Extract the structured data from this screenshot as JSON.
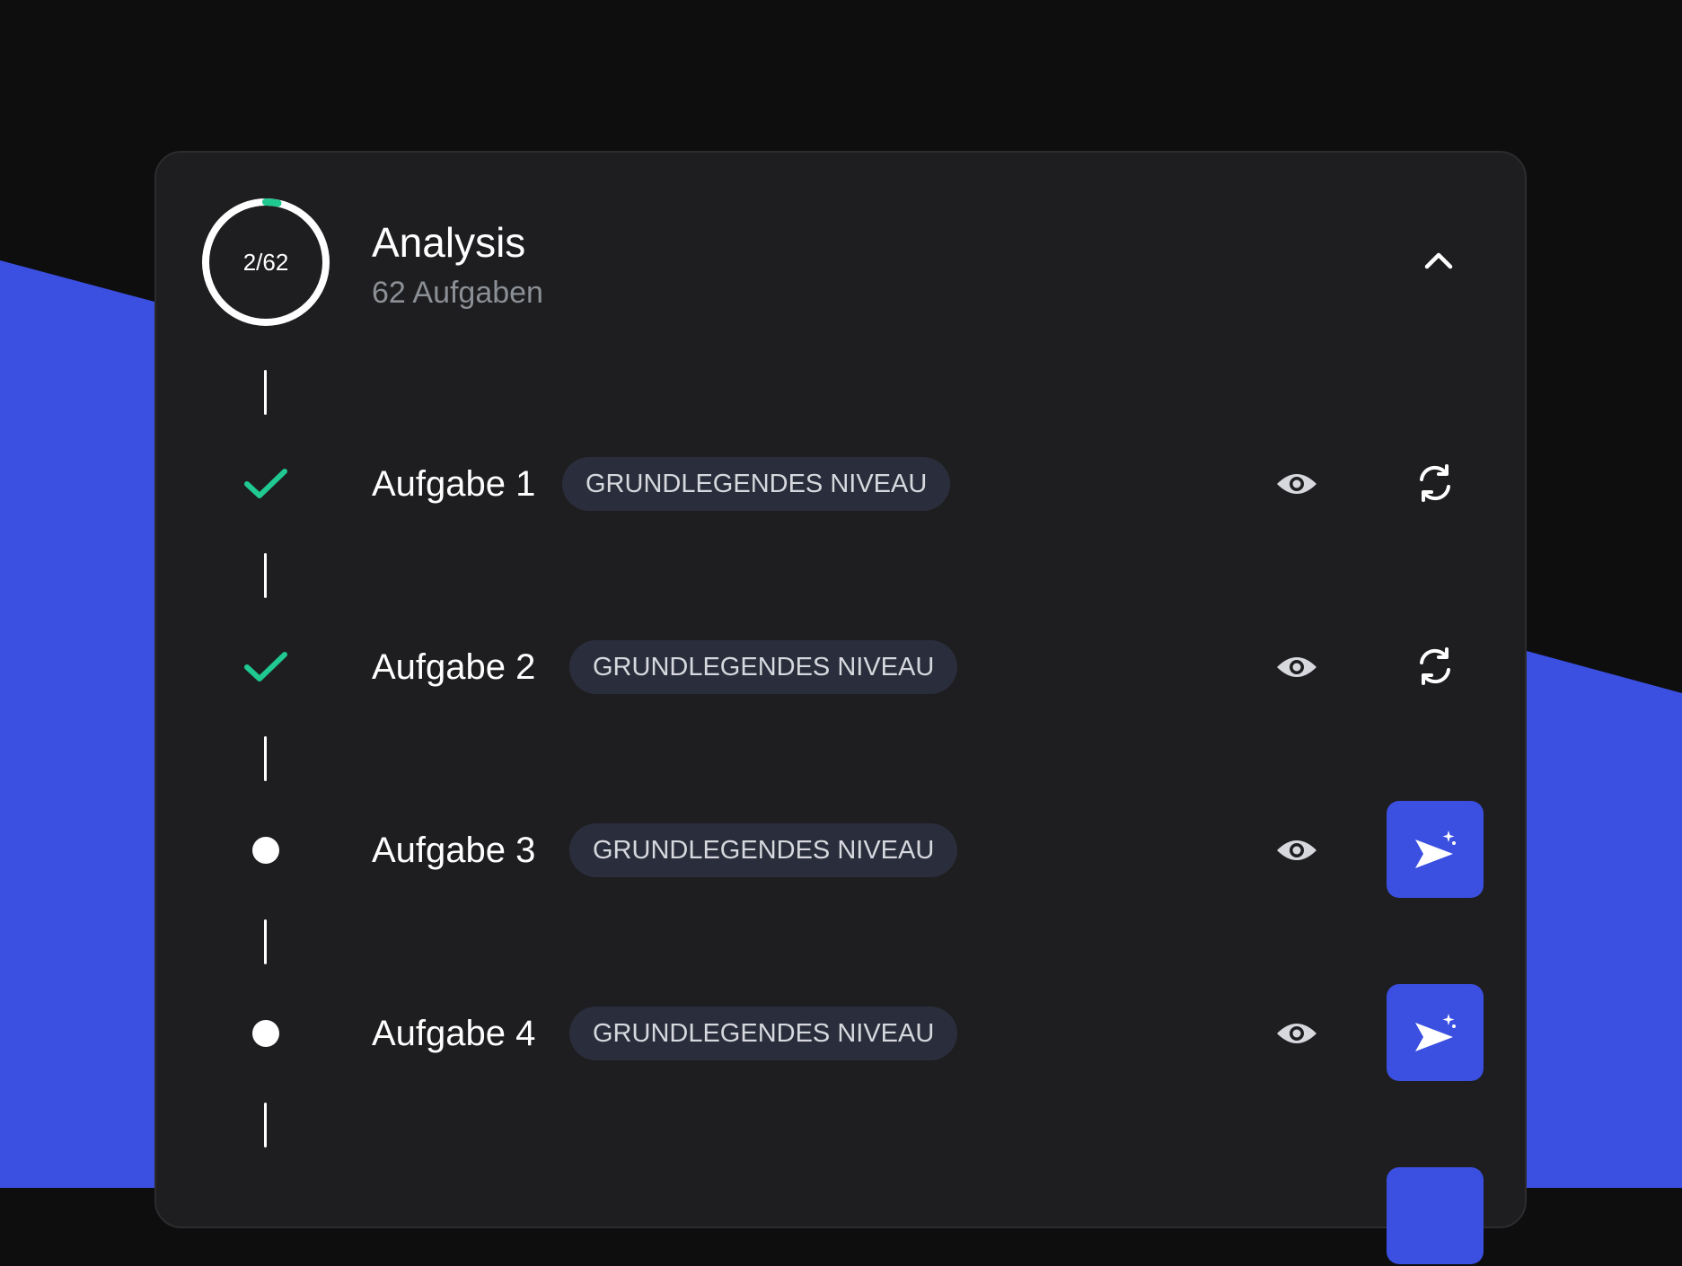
{
  "colors": {
    "accent": "#3b4fe0",
    "success": "#1fc990",
    "card": "#1e1e20",
    "badge": "#2a2d3b",
    "muted": "#8b8f96"
  },
  "section": {
    "title": "Analysis",
    "subtitle": "62 Aufgaben",
    "progress": {
      "label": "2/62",
      "done": 2,
      "total": 62
    },
    "collapse_icon": "chevron-up-icon"
  },
  "tasks": [
    {
      "label": "Aufgabe 1",
      "badge": "GRUNDLEGENDES NIVEAU",
      "status": "done",
      "view_icon": "eye-icon",
      "action_icon": "retry-icon"
    },
    {
      "label": "Aufgabe 2",
      "badge": "GRUNDLEGENDES NIVEAU",
      "status": "done",
      "view_icon": "eye-icon",
      "action_icon": "retry-icon"
    },
    {
      "label": "Aufgabe 3",
      "badge": "GRUNDLEGENDES NIVEAU",
      "status": "open",
      "view_icon": "eye-icon",
      "action_icon": "send-sparkle-icon"
    },
    {
      "label": "Aufgabe 4",
      "badge": "GRUNDLEGENDES NIVEAU",
      "status": "open",
      "view_icon": "eye-icon",
      "action_icon": "send-sparkle-icon"
    }
  ]
}
